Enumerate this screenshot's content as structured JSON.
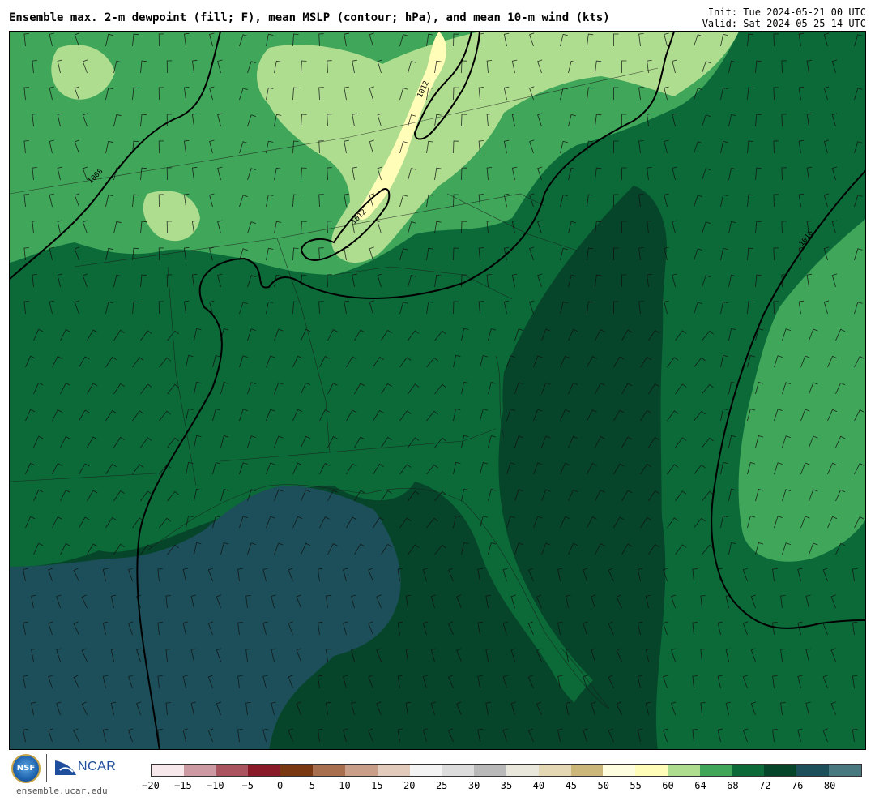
{
  "header": {
    "title": "Ensemble max. 2-m dewpoint (fill; F), mean MSLP (contour; hPa), and mean 10-m wind (kts)",
    "init": "Init: Tue 2024-05-21 00 UTC",
    "valid": "Valid: Sat 2024-05-25 14 UTC"
  },
  "map": {
    "fill_colors": {
      "f55": "#fffdb8",
      "f60": "#aedd8f",
      "f64": "#3fa65a",
      "f68": "#0b6a38",
      "f72": "#06452a",
      "f76": "#1c4f5a"
    },
    "contours": [
      {
        "label": "1008"
      },
      {
        "label": "1012"
      },
      {
        "label": "1012"
      },
      {
        "label": "1016"
      }
    ]
  },
  "colorbar": {
    "colors": [
      "#f7e8ec",
      "#cc9aa3",
      "#a9545f",
      "#8a1a28",
      "#7a3812",
      "#a86f4e",
      "#c8a08a",
      "#e3cbbc",
      "#f3f3f3",
      "#dcdcdc",
      "#b9b9b9",
      "#e9e6dc",
      "#e4d7b3",
      "#ccb77b",
      "#fffde0",
      "#fffdb8",
      "#aedd8f",
      "#3fa65a",
      "#0b6a38",
      "#06452a",
      "#1c4f5a",
      "#4a7880"
    ],
    "tick_labels": [
      "−20",
      "−15",
      "−10",
      "−5",
      "0",
      "5",
      "10",
      "15",
      "20",
      "25",
      "30",
      "35",
      "40",
      "45",
      "50",
      "55",
      "60",
      "64",
      "68",
      "72",
      "76",
      "80"
    ]
  },
  "footer": {
    "site": "ensemble.ucar.edu",
    "nsf_logo": "NSF",
    "ncar_logo": "NCAR"
  }
}
